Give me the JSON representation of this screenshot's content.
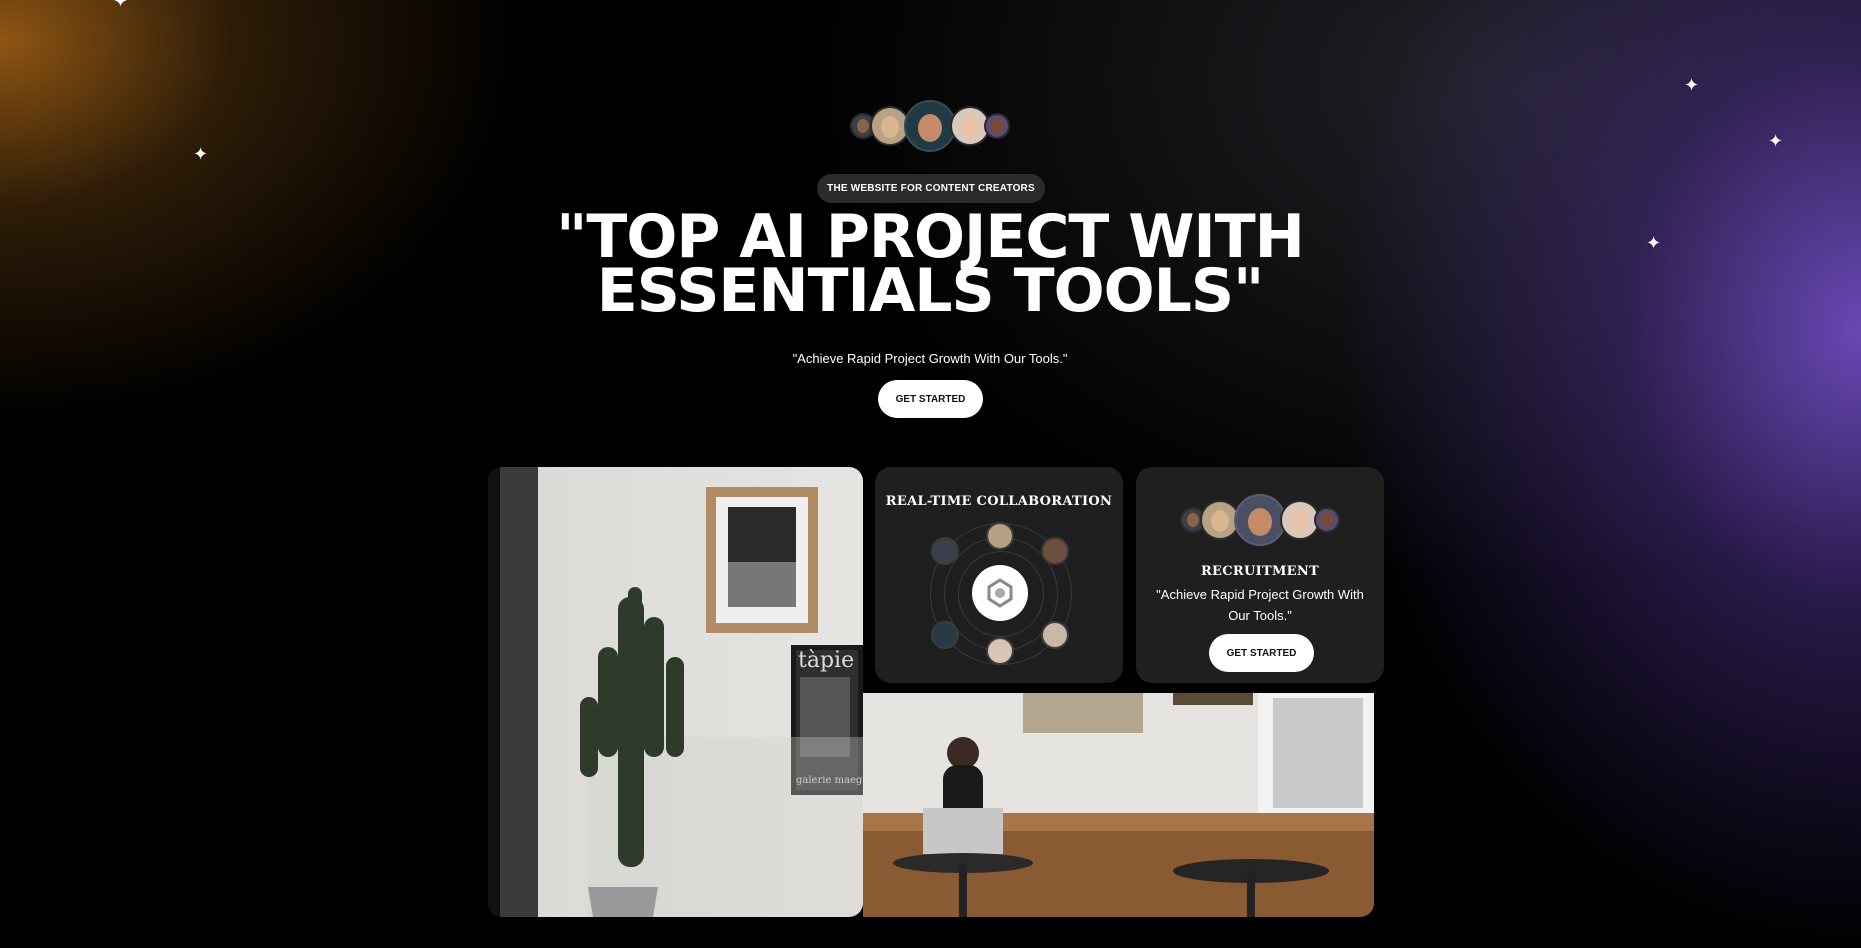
{
  "hero": {
    "tag": "THE WEBSITE FOR CONTENT CREATORS",
    "headline_line1": "\"TOP AI PROJECT WITH",
    "headline_line2": "ESSENTIALS TOOLS\"",
    "subtitle": "\"Achieve Rapid Project Growth With Our Tools.\"",
    "cta_label": "GET STARTED"
  },
  "collab_card": {
    "title": "REAL-TIME COLLABORATION",
    "center_icon": "sparkle-logo-icon"
  },
  "recruit_card": {
    "title": "RECRUITMENT",
    "description": "\"Achieve Rapid Project Growth With Our Tools.\"",
    "cta_label": "GET STARTED"
  },
  "colors": {
    "background": "#000000",
    "glow_left": "#965a14",
    "glow_right": "#6e4bbe",
    "card": "#1f1f1f",
    "button": "#ffffff"
  }
}
